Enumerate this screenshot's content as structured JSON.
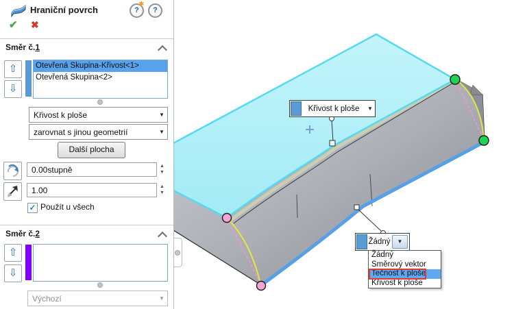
{
  "panel": {
    "title": "Hraniční povrch",
    "dir1": {
      "label_prefix": "Směr č.",
      "label_accel": "1",
      "items": [
        "Otevřená Skupina-Křivost<1>",
        "Otevřená Skupina<2>"
      ],
      "selected_item": "Otevřená Skupina-Křivost<1>",
      "tangency_type": "Křivost k ploše",
      "alignment": "zarovnat s jinou geometrií",
      "next_face_button": "Další plocha",
      "draft_angle": "0.00stupně",
      "tangent_length": "1.00",
      "apply_all_label": "Použít u všech",
      "apply_all_checked": true
    },
    "dir2": {
      "label_prefix": "Směr č.",
      "label_accel": "2",
      "items": [],
      "curves_influence": "Výchozí"
    }
  },
  "viewport": {
    "surface_callout": {
      "label": "Křivost k ploše"
    },
    "edge_callout": {
      "value": "Žádný",
      "options": [
        "Žádný",
        "Směrový vektor",
        "Tečnost k ploše",
        "Křivost k ploše"
      ],
      "highlighted_option": "Tečnost k ploše"
    }
  },
  "colors": {
    "accent_blue": "#5b9bd5",
    "selection_blue": "#57a2ea",
    "purple_bar": "#7f00ff",
    "preview_cyan": "#aceef8",
    "edge_cyan": "#55d9f2",
    "edge_blue": "#58a0e6",
    "connector_green": "#1fd355",
    "connector_pink": "#f6a3da",
    "curve_yellow": "#e6e63e",
    "highlight_red": "#e23b2e"
  }
}
